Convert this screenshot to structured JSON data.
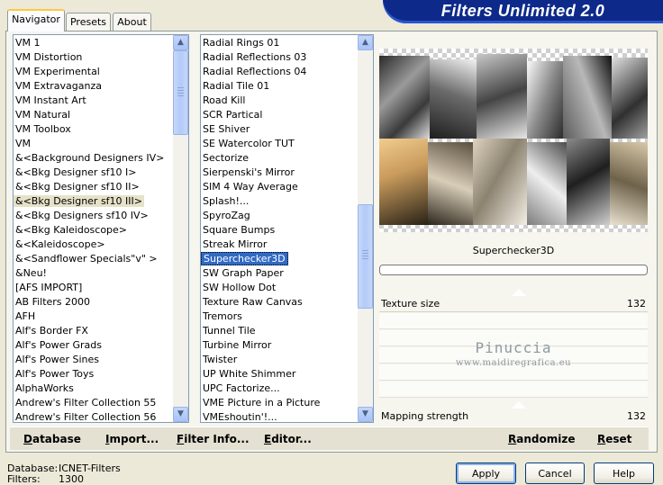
{
  "window": {
    "title": "Filters Unlimited 2.0"
  },
  "tabs": [
    {
      "label": "Navigator",
      "active": true
    },
    {
      "label": "Presets",
      "active": false
    },
    {
      "label": "About",
      "active": false
    }
  ],
  "categories": {
    "items": [
      "VM 1",
      "VM Distortion",
      "VM Experimental",
      "VM Extravaganza",
      "VM Instant Art",
      "VM Natural",
      "VM Toolbox",
      "VM",
      "&<Background Designers IV>",
      "&<Bkg Designer sf10 I>",
      "&<Bkg Designer sf10 II>",
      "&<Bkg Designer sf10 III>",
      "&<Bkg Designers sf10 IV>",
      "&<Bkg Kaleidoscope>",
      "&<Kaleidoscope>",
      "&<Sandflower Specials\"v\" >",
      "&Neu!",
      "[AFS IMPORT]",
      "AB Filters 2000",
      "AFH",
      "Alf's Border FX",
      "Alf's Power Grads",
      "Alf's Power Sines",
      "Alf's Power Toys",
      "AlphaWorks",
      "Andrew's Filter Collection 55",
      "Andrew's Filter Collection 56"
    ],
    "highlighted_index": 11
  },
  "filters": {
    "items": [
      "Radial  Rings 01",
      "Radial Reflections 03",
      "Radial Reflections 04",
      "Radial Tile 01",
      "Road Kill",
      "SCR  Partical",
      "SE Shiver",
      "SE Watercolor TUT",
      "Sectorize",
      "Sierpenski's Mirror",
      "SIM 4 Way Average",
      "Splash!...",
      "SpyroZag",
      "Square Bumps",
      "Streak Mirror",
      "Superchecker3D",
      "SW Graph Paper",
      "SW Hollow Dot",
      "Texture Raw Canvas",
      "Tremors",
      "Tunnel Tile",
      "Turbine Mirror",
      "Twister",
      "UP White Shimmer",
      "UPC Factorize...",
      "VME Picture in a Picture",
      "VMEshoutin'!..."
    ],
    "selected_index": 15
  },
  "preview": {
    "filter_name": "Superchecker3D",
    "progress": 0
  },
  "sliders": [
    {
      "label": "Texture size",
      "value": "132"
    },
    {
      "label": "Mapping strength",
      "value": "132"
    }
  ],
  "watermark": {
    "line1": "Pinuccia",
    "line2": "www.maidiregrafica.eu"
  },
  "toolbar": {
    "database": "Database",
    "import": "Import...",
    "filter_info": "Filter Info...",
    "editor": "Editor...",
    "randomize": "Randomize",
    "reset": "Reset"
  },
  "status": {
    "database_label": "Database:",
    "database_value": "ICNET-Filters",
    "filters_label": "Filters:",
    "filters_value": "1300"
  },
  "buttons": {
    "apply": "Apply",
    "cancel": "Cancel",
    "help": "Help"
  },
  "icons": {
    "scroll_up": "scroll-up-icon",
    "scroll_down": "scroll-down-icon"
  }
}
